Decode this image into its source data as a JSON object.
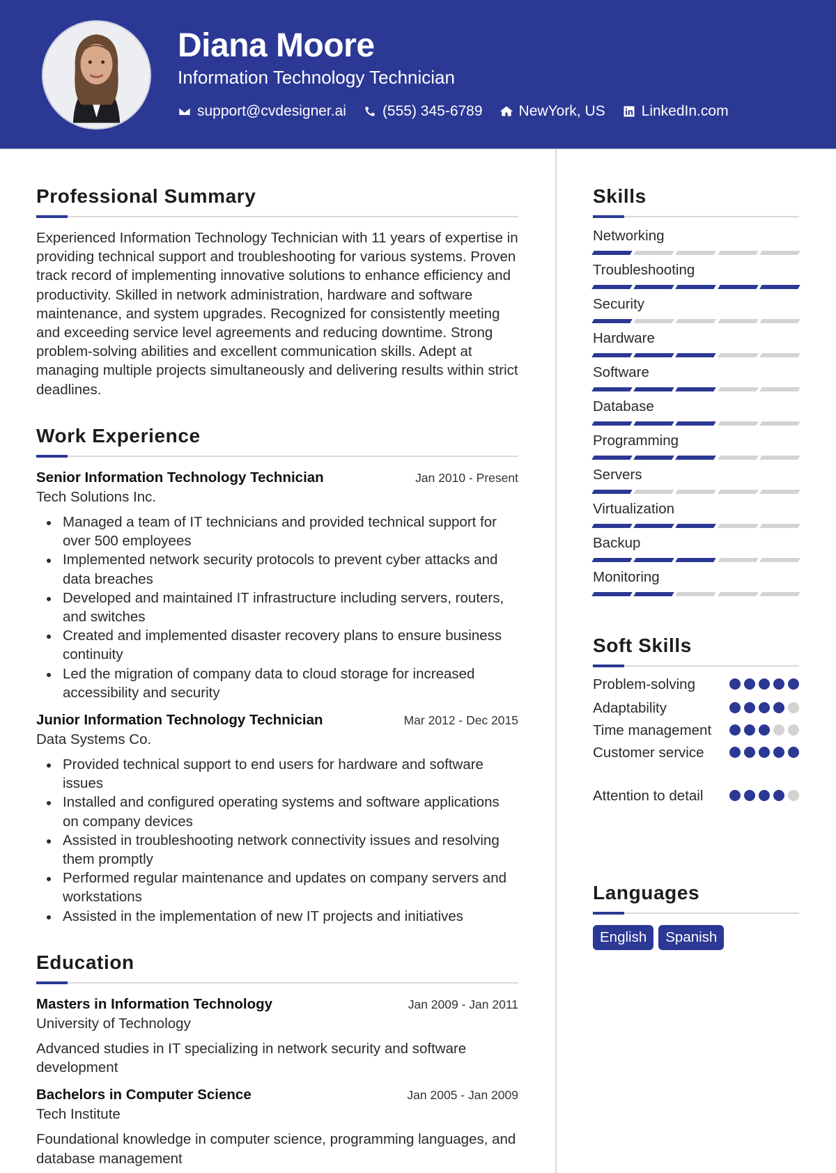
{
  "header": {
    "name": "Diana Moore",
    "title": "Information Technology Technician",
    "photo_alt": "profile-photo",
    "contacts": [
      {
        "icon": "envelope-icon",
        "text": "support@cvdesigner.ai"
      },
      {
        "icon": "phone-icon",
        "text": "(555) 345-6789"
      },
      {
        "icon": "home-icon",
        "text": "NewYork, US"
      },
      {
        "icon": "linkedin-icon",
        "text": "LinkedIn.com"
      }
    ]
  },
  "colors": {
    "accent": "#2b3894",
    "inactive": "#d3d3d3",
    "divider": "#d8d8d8"
  },
  "summary": {
    "heading": "Professional Summary",
    "text": "Experienced Information Technology Technician with 11 years of expertise in providing technical support and troubleshooting for various systems. Proven track record of implementing innovative solutions to enhance efficiency and productivity. Skilled in network administration, hardware and software maintenance, and system upgrades. Recognized for consistently meeting and exceeding service level agreements and reducing downtime. Strong problem-solving abilities and excellent communication skills. Adept at managing multiple projects simultaneously and delivering results within strict deadlines."
  },
  "experience": {
    "heading": "Work Experience",
    "jobs": [
      {
        "title": "Senior Information Technology Technician",
        "date": "Jan 2010 - Present",
        "company": "Tech Solutions Inc.",
        "bullets": [
          "Managed a team of IT technicians and provided technical support for over 500 employees",
          "Implemented network security protocols to prevent cyber attacks and data breaches",
          "Developed and maintained IT infrastructure including servers, routers, and switches",
          "Created and implemented disaster recovery plans to ensure business continuity",
          "Led the migration of company data to cloud storage for increased accessibility and security"
        ]
      },
      {
        "title": "Junior Information Technology Technician",
        "date": "Mar 2012 - Dec 2015",
        "company": "Data Systems Co.",
        "bullets": [
          "Provided technical support to end users for hardware and software issues",
          "Installed and configured operating systems and software applications on company devices",
          "Assisted in troubleshooting network connectivity issues and resolving them promptly",
          "Performed regular maintenance and updates on company servers and workstations",
          "Assisted in the implementation of new IT projects and initiatives"
        ]
      }
    ]
  },
  "education": {
    "heading": "Education",
    "items": [
      {
        "degree": "Masters in Information Technology",
        "date": "Jan 2009 - Jan 2011",
        "school": "University of Technology",
        "description": "Advanced studies in IT specializing in network security and software development"
      },
      {
        "degree": "Bachelors in Computer Science",
        "date": "Jan 2005 - Jan 2009",
        "school": "Tech Institute",
        "description": "Foundational knowledge in computer science, programming languages, and database management"
      }
    ]
  },
  "skills": {
    "heading": "Skills",
    "max_level": 5,
    "items": [
      {
        "name": "Networking",
        "level": 1
      },
      {
        "name": "Troubleshooting",
        "level": 5
      },
      {
        "name": "Security",
        "level": 1
      },
      {
        "name": "Hardware",
        "level": 3
      },
      {
        "name": "Software",
        "level": 3
      },
      {
        "name": "Database",
        "level": 3
      },
      {
        "name": "Programming",
        "level": 3
      },
      {
        "name": "Servers",
        "level": 1
      },
      {
        "name": "Virtualization",
        "level": 3
      },
      {
        "name": "Backup",
        "level": 3
      },
      {
        "name": "Monitoring",
        "level": 2
      }
    ]
  },
  "soft_skills": {
    "heading": "Soft Skills",
    "max_level": 5,
    "items": [
      {
        "name": "Problem-solving",
        "level": 5
      },
      {
        "name": "Adaptability",
        "level": 4
      },
      {
        "name": "Time management",
        "level": 3
      },
      {
        "name": "Customer service",
        "level": 5
      },
      {
        "name": "Attention to detail",
        "level": 4
      }
    ]
  },
  "languages": {
    "heading": "Languages",
    "items": [
      "English",
      "Spanish"
    ]
  }
}
